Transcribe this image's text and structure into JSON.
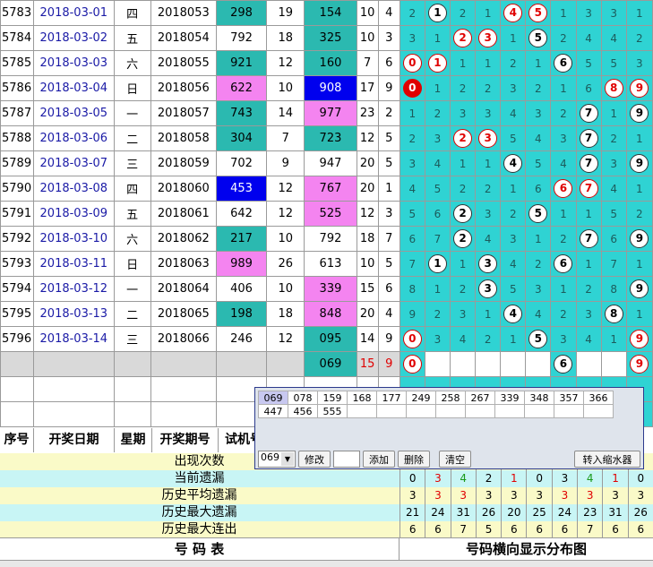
{
  "rows": [
    {
      "seq": "5783",
      "date": "2018-03-01",
      "weekday": "四",
      "issue": "2018053",
      "trial": "298",
      "sum": "19",
      "result": "154",
      "span": "10",
      "count": "4",
      "dist": [
        "2",
        "1",
        "2",
        "1",
        "4",
        "5",
        "1",
        "3",
        "3",
        "1"
      ]
    },
    {
      "seq": "5784",
      "date": "2018-03-02",
      "weekday": "五",
      "issue": "2018054",
      "trial": "792",
      "sum": "18",
      "result": "325",
      "span": "10",
      "count": "3",
      "dist": [
        "3",
        "1",
        "2",
        "3",
        "1",
        "5",
        "2",
        "4",
        "4",
        "2"
      ]
    },
    {
      "seq": "5785",
      "date": "2018-03-03",
      "weekday": "六",
      "issue": "2018055",
      "trial": "921",
      "sum": "12",
      "result": "160",
      "span": "7",
      "count": "6",
      "dist": [
        "0",
        "1",
        "1",
        "1",
        "2",
        "1",
        "6",
        "5",
        "5",
        "3"
      ]
    },
    {
      "seq": "5786",
      "date": "2018-03-04",
      "weekday": "日",
      "issue": "2018056",
      "trial": "622",
      "sum": "10",
      "result": "908",
      "span": "17",
      "count": "9",
      "dist": [
        "0",
        "1",
        "2",
        "2",
        "3",
        "2",
        "1",
        "6",
        "8",
        "9"
      ]
    },
    {
      "seq": "5787",
      "date": "2018-03-05",
      "weekday": "一",
      "issue": "2018057",
      "trial": "743",
      "sum": "14",
      "result": "977",
      "span": "23",
      "count": "2",
      "dist": [
        "1",
        "2",
        "3",
        "3",
        "4",
        "3",
        "2",
        "7",
        "1",
        "9"
      ]
    },
    {
      "seq": "5788",
      "date": "2018-03-06",
      "weekday": "二",
      "issue": "2018058",
      "trial": "304",
      "sum": "7",
      "result": "723",
      "span": "12",
      "count": "5",
      "dist": [
        "2",
        "3",
        "2",
        "3",
        "5",
        "4",
        "3",
        "7",
        "2",
        "1"
      ]
    },
    {
      "seq": "5789",
      "date": "2018-03-07",
      "weekday": "三",
      "issue": "2018059",
      "trial": "702",
      "sum": "9",
      "result": "947",
      "span": "20",
      "count": "5",
      "dist": [
        "3",
        "4",
        "1",
        "1",
        "4",
        "5",
        "4",
        "7",
        "3",
        "9"
      ]
    },
    {
      "seq": "5790",
      "date": "2018-03-08",
      "weekday": "四",
      "issue": "2018060",
      "trial": "453",
      "sum": "12",
      "result": "767",
      "span": "20",
      "count": "1",
      "dist": [
        "4",
        "5",
        "2",
        "2",
        "1",
        "6",
        "6",
        "7",
        "4",
        "1"
      ]
    },
    {
      "seq": "5791",
      "date": "2018-03-09",
      "weekday": "五",
      "issue": "2018061",
      "trial": "642",
      "sum": "12",
      "result": "525",
      "span": "12",
      "count": "3",
      "dist": [
        "5",
        "6",
        "2",
        "3",
        "2",
        "5",
        "1",
        "1",
        "5",
        "2"
      ]
    },
    {
      "seq": "5792",
      "date": "2018-03-10",
      "weekday": "六",
      "issue": "2018062",
      "trial": "217",
      "sum": "10",
      "result": "792",
      "span": "18",
      "count": "7",
      "dist": [
        "6",
        "7",
        "2",
        "4",
        "3",
        "1",
        "2",
        "7",
        "6",
        "9"
      ]
    },
    {
      "seq": "5793",
      "date": "2018-03-11",
      "weekday": "日",
      "issue": "2018063",
      "trial": "989",
      "sum": "26",
      "result": "613",
      "span": "10",
      "count": "5",
      "dist": [
        "7",
        "1",
        "1",
        "3",
        "4",
        "2",
        "6",
        "1",
        "7",
        "1"
      ]
    },
    {
      "seq": "5794",
      "date": "2018-03-12",
      "weekday": "一",
      "issue": "2018064",
      "trial": "406",
      "sum": "10",
      "result": "339",
      "span": "15",
      "count": "6",
      "dist": [
        "8",
        "1",
        "2",
        "3",
        "5",
        "3",
        "1",
        "2",
        "8",
        "9"
      ]
    },
    {
      "seq": "5795",
      "date": "2018-03-13",
      "weekday": "二",
      "issue": "2018065",
      "trial": "198",
      "sum": "18",
      "result": "848",
      "span": "20",
      "count": "4",
      "dist": [
        "9",
        "2",
        "3",
        "1",
        "4",
        "4",
        "2",
        "3",
        "8",
        "1"
      ]
    },
    {
      "seq": "5796",
      "date": "2018-03-14",
      "weekday": "三",
      "issue": "2018066",
      "trial": "246",
      "sum": "12",
      "result": "095",
      "span": "14",
      "count": "9",
      "dist": [
        "0",
        "3",
        "4",
        "2",
        "1",
        "5",
        "3",
        "4",
        "1",
        "9"
      ]
    },
    {
      "seq": "",
      "date": "",
      "weekday": "",
      "issue": "",
      "trial": "",
      "sum": "",
      "result": "069",
      "span": "15",
      "count": "9",
      "dist": [
        "0",
        "",
        "",
        "",
        "",
        "",
        "6",
        "",
        "",
        "9"
      ]
    }
  ],
  "header": {
    "seq": "序号",
    "date": "开奖日期",
    "weekday": "星期",
    "issue": "开奖期号",
    "trial": "试机号"
  },
  "stats": [
    {
      "label": "出现次数",
      "values": [
        "",
        "",
        "",
        "",
        "",
        "",
        "",
        "",
        "",
        ""
      ]
    },
    {
      "label": "当前遗漏",
      "values": [
        "0",
        "3",
        "4",
        "2",
        "1",
        "0",
        "3",
        "4",
        "1",
        "0"
      ]
    },
    {
      "label": "历史平均遗漏",
      "values": [
        "3",
        "3",
        "3",
        "3",
        "3",
        "3",
        "3",
        "3",
        "3",
        "3"
      ]
    },
    {
      "label": "历史最大遗漏",
      "values": [
        "21",
        "24",
        "31",
        "26",
        "20",
        "25",
        "24",
        "23",
        "31",
        "26"
      ]
    },
    {
      "label": "历史最大连出",
      "values": [
        "6",
        "6",
        "7",
        "5",
        "6",
        "6",
        "6",
        "7",
        "6",
        "6"
      ]
    }
  ],
  "footer": {
    "left": "号  码  表",
    "right": "号码横向显示分布图"
  },
  "popup": {
    "numbers_row1": [
      "069",
      "078",
      "159",
      "168",
      "177",
      "249",
      "258",
      "267",
      "339",
      "348",
      "357",
      "366"
    ],
    "numbers_row2": [
      "447",
      "456",
      "555",
      "",
      "",
      "",
      "",
      "",
      "",
      "",
      "",
      ""
    ],
    "select_value": "069",
    "btn_modify": "修改",
    "btn_add": "添加",
    "btn_delete": "删除",
    "btn_clear": "清空",
    "btn_shrink": "转入缩水器"
  },
  "colors": {
    "teal": "#2fd3d3",
    "dark_teal": "#2bb9b0",
    "pink": "#f484f0",
    "navy": "#0000ee",
    "red": "#e00000"
  }
}
